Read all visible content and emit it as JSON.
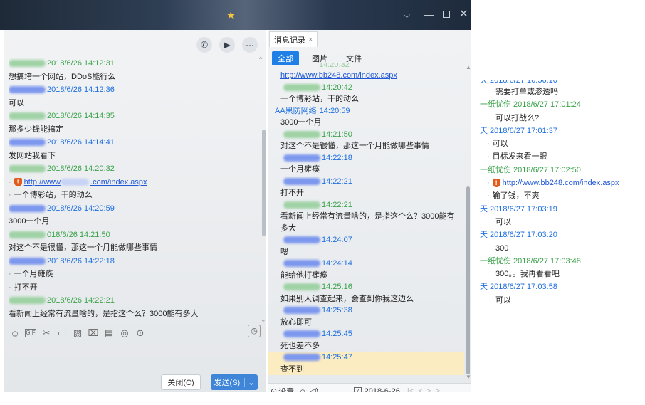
{
  "left": {
    "messages": [
      {
        "kind": "name",
        "color": "g",
        "time": "2018/6/26 14:12:31"
      },
      {
        "kind": "text",
        "text": "想搞垮一个网站，DDoS能行么"
      },
      {
        "kind": "name",
        "color": "b",
        "time": "2018/6/26 14:12:36"
      },
      {
        "kind": "text",
        "text": "可以"
      },
      {
        "kind": "name",
        "color": "g",
        "time": "2018/6/26 14:14:35"
      },
      {
        "kind": "text",
        "text": "那多少钱能搞定"
      },
      {
        "kind": "name",
        "color": "b",
        "time": "2018/6/26 14:14:41"
      },
      {
        "kind": "text",
        "text": "发网站我看下"
      },
      {
        "kind": "name",
        "color": "g",
        "time": "2018/6/26 14:20:32"
      },
      {
        "kind": "link",
        "prefix": "http://www",
        "suffix": ".com/index.aspx"
      },
      {
        "kind": "bullet",
        "text": "一个博彩站，干的动么"
      },
      {
        "kind": "name",
        "color": "b",
        "time": "2018/6/26 14:20:59"
      },
      {
        "kind": "text",
        "text": "3000一个月"
      },
      {
        "kind": "name",
        "color": "g",
        "time": "018/6/26 14:21:50"
      },
      {
        "kind": "text",
        "text": "对这个不是很懂，那这一个月能做哪些事情"
      },
      {
        "kind": "name",
        "color": "b",
        "time": "2018/6/26 14:22:18"
      },
      {
        "kind": "bullet",
        "text": "一个月瘫痪"
      },
      {
        "kind": "bullet",
        "text": "打不开"
      },
      {
        "kind": "name",
        "color": "g",
        "time": "2018/6/26 14:22:21"
      },
      {
        "kind": "text",
        "text": "看新闻上经常有流量啥的，是指这个么？3000能有多大"
      }
    ],
    "buttons": {
      "close": "关闭(C)",
      "send": "发送(S)"
    },
    "toolbar_icons": [
      "smile-icon",
      "gif-icon",
      "scissors-icon",
      "folder-icon",
      "image-icon",
      "shake-icon",
      "doc-icon",
      "dice-icon",
      "more-icon"
    ]
  },
  "middle": {
    "tab_title": "消息记录",
    "tab_close": "×",
    "filters": [
      "全部",
      "图片",
      "文件"
    ],
    "top_time": "14:20:32",
    "messages": [
      {
        "kind": "link",
        "text": "http://www.bb248.com/index.aspx"
      },
      {
        "kind": "name",
        "color": "g",
        "time": "14:20:42"
      },
      {
        "kind": "text",
        "text": "一个博彩站，干的动么"
      },
      {
        "kind": "fullname",
        "color": "b",
        "name": "AA黑防网络",
        "time": "14:20:59"
      },
      {
        "kind": "text",
        "text": "3000一个月"
      },
      {
        "kind": "name",
        "color": "g",
        "time": "14:21:50"
      },
      {
        "kind": "text",
        "text": "对这个不是很懂，那这一个月能做哪些事情"
      },
      {
        "kind": "name",
        "color": "b",
        "time": "14:22:18"
      },
      {
        "kind": "text",
        "text": "一个月瘫痪"
      },
      {
        "kind": "name",
        "color": "b",
        "time": "14:22:21"
      },
      {
        "kind": "text",
        "text": "打不开"
      },
      {
        "kind": "name",
        "color": "g",
        "time": "14:22:21"
      },
      {
        "kind": "text",
        "text": "看新闻上经常有流量啥的，是指这个么？3000能有"
      },
      {
        "kind": "text",
        "text": "多大"
      },
      {
        "kind": "name",
        "color": "b",
        "time": "14:24:07"
      },
      {
        "kind": "text",
        "text": "嗯"
      },
      {
        "kind": "name",
        "color": "b",
        "time": "14:24:14"
      },
      {
        "kind": "text",
        "text": "能给他打瘫痪"
      },
      {
        "kind": "name",
        "color": "g",
        "time": "14:25:16"
      },
      {
        "kind": "text",
        "text": "如果别人调查起来，会查到你我这边么"
      },
      {
        "kind": "name",
        "color": "b",
        "time": "14:25:38"
      },
      {
        "kind": "text",
        "text": "放心即可"
      },
      {
        "kind": "name",
        "color": "b",
        "time": "14:25:45"
      },
      {
        "kind": "text",
        "text": "死也差不多"
      },
      {
        "kind": "name",
        "color": "b",
        "time": "14:25:47",
        "highlight": true
      },
      {
        "kind": "text",
        "text": "查不到",
        "highlight": true
      }
    ],
    "bottom": {
      "settings": "设置",
      "date": "2018-6-26"
    }
  },
  "right": {
    "messages": [
      {
        "kind": "name",
        "color": "b",
        "text": "天 2018/6/27 16:56:10"
      },
      {
        "kind": "text",
        "text": "需要打单或渗透吗"
      },
      {
        "kind": "name",
        "color": "g",
        "text": "一纸忧伤 2018/6/27 17:01:24"
      },
      {
        "kind": "text",
        "text": "可以打战么?"
      },
      {
        "kind": "name",
        "color": "b",
        "text": "天 2018/6/27 17:01:37"
      },
      {
        "kind": "bullet",
        "text": "可以"
      },
      {
        "kind": "bullet",
        "text": "目标发来看一眼"
      },
      {
        "kind": "name",
        "color": "g",
        "text": "一纸忧伤 2018/6/27 17:02:50"
      },
      {
        "kind": "link",
        "text": "http://www.bb248.com/index.aspx"
      },
      {
        "kind": "bullet",
        "text": "输了钱，不爽"
      },
      {
        "kind": "name",
        "color": "b",
        "text": "天 2018/6/27 17:03:19"
      },
      {
        "kind": "text",
        "text": "可以"
      },
      {
        "kind": "name",
        "color": "b",
        "text": "天 2018/6/27 17:03:20"
      },
      {
        "kind": "text",
        "text": "300"
      },
      {
        "kind": "name",
        "color": "g",
        "text": "一纸忧伤 2018/6/27 17:03:48"
      },
      {
        "kind": "text",
        "text": "300。。我再看看吧"
      },
      {
        "kind": "name",
        "color": "b",
        "text": "天 2018/6/27 17:03:58"
      },
      {
        "kind": "text",
        "text": "可以"
      }
    ]
  },
  "colors": {
    "accent": "#1e7fe6",
    "green_name": "#3aa34a",
    "blue_name": "#1f6fe0",
    "highlight": "#fcecc2"
  }
}
